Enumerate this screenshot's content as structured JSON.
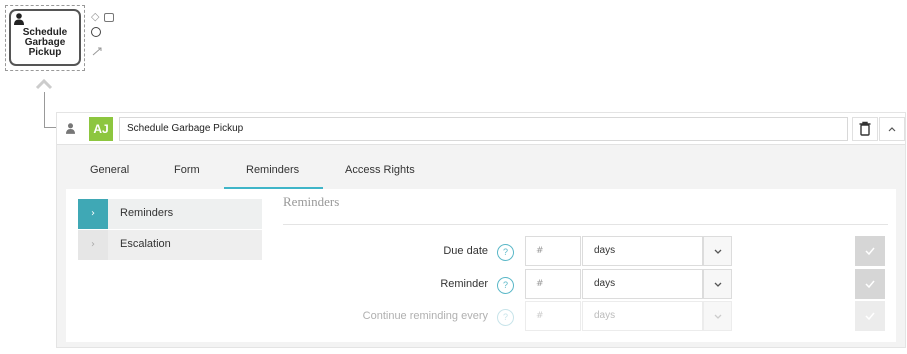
{
  "diagram": {
    "task_label": "Schedule\nGarbage Pickup",
    "icons": [
      "user-icon",
      "gateway-icon",
      "task-icon",
      "event-icon",
      "connect-icon",
      "chevron-up-icon"
    ]
  },
  "panel": {
    "header": {
      "avatar": "AJ",
      "title": "Schedule Garbage Pickup",
      "icons": [
        "user-icon",
        "trash-icon",
        "chevron-up-icon"
      ]
    },
    "tabs": [
      "General",
      "Form",
      "Reminders",
      "Access Rights"
    ],
    "active_tab": "Reminders",
    "side": [
      {
        "label": "Reminders",
        "active": true
      },
      {
        "label": "Escalation",
        "active": false
      }
    ],
    "section_title": "Reminders",
    "rows": [
      {
        "label": "Due date",
        "help": "?",
        "number_placeholder": "#",
        "unit": "days"
      },
      {
        "label": "Reminder",
        "help": "?",
        "number_placeholder": "#",
        "unit": "days"
      },
      {
        "label": "Continue reminding every",
        "help": "?",
        "number_placeholder": "#",
        "unit": "days"
      }
    ]
  },
  "colors": {
    "accent": "#3fb5c8",
    "avatar": "#8dc63f"
  }
}
